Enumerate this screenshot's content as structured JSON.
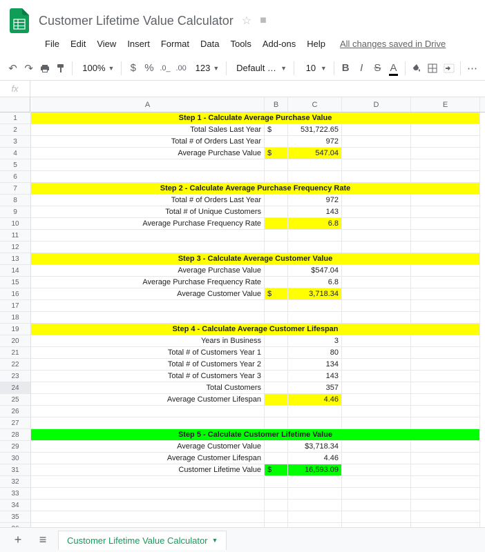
{
  "doc": {
    "title": "Customer Lifetime Value Calculator",
    "save_status": "All changes saved in Drive"
  },
  "menus": [
    "File",
    "Edit",
    "View",
    "Insert",
    "Format",
    "Data",
    "Tools",
    "Add-ons",
    "Help"
  ],
  "toolbar": {
    "zoom": "100%",
    "font_name": "Default (Ari...",
    "font_size": "10",
    "more_formats": "123"
  },
  "formula_bar": {
    "fx": "fx",
    "value": ""
  },
  "columns": [
    "A",
    "B",
    "C",
    "D",
    "E"
  ],
  "sheet_tab": "Customer Lifetime Value Calculator",
  "sheet": {
    "step1": {
      "header": "Step 1 - Calculate Average Purchase Value",
      "r2_label": "Total Sales Last Year",
      "r2_b": "$",
      "r2_c": "531,722.65",
      "r3_label": "Total # of Orders Last Year",
      "r3_c": "972",
      "r4_label": "Average Purchase Value",
      "r4_b": "$",
      "r4_c": "547.04"
    },
    "step2": {
      "header": "Step 2 - Calculate Average Purchase Frequency Rate",
      "r8_label": "Total # of Orders Last Year",
      "r8_c": "972",
      "r9_label": "Total # of Unique Customers",
      "r9_c": "143",
      "r10_label": "Average Purchase Frequency Rate",
      "r10_c": "6.8"
    },
    "step3": {
      "header": "Step 3 - Calculate Average Customer Value",
      "r14_label": "Average Purchase Value",
      "r14_c": "$547.04",
      "r15_label": "Average Purchase Frequency Rate",
      "r15_c": "6.8",
      "r16_label": "Average Customer Value",
      "r16_b": "$",
      "r16_c": "3,718.34"
    },
    "step4": {
      "header": "Step 4 - Calculate Average Customer Lifespan",
      "r20_label": "Years in Business",
      "r20_c": "3",
      "r21_label": "Total # of Customers Year 1",
      "r21_c": "80",
      "r22_label": "Total # of Customers Year 2",
      "r22_c": "134",
      "r23_label": "Total # of Customers Year 3",
      "r23_c": "143",
      "r24_label": "Total Customers",
      "r24_c": "357",
      "r25_label": "Average Customer Lifespan",
      "r25_c": "4.46"
    },
    "step5": {
      "header": "Step 5 - Calculate Customer Lifetime Value",
      "r29_label": "Average Customer Value",
      "r29_c": "$3,718.34",
      "r30_label": "Average Customer Lifespan",
      "r30_c": "4.46",
      "r31_label": "Customer Lifetime Value",
      "r31_b": "$",
      "r31_c": "16,593.09"
    }
  }
}
